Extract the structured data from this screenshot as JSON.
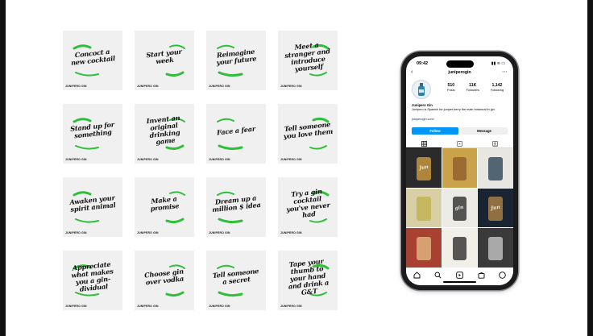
{
  "colors": {
    "tile_bg": "#f0f0f0",
    "lettering": "#111111",
    "brand_green": "#2fbf3a",
    "ig_blue": "#0095f6"
  },
  "tiles": [
    {
      "text": "Concoct a new cocktail"
    },
    {
      "text": "Start your week"
    },
    {
      "text": "Reimagine your future"
    },
    {
      "text": "Meet a stranger and introduce yourself"
    },
    {
      "text": "Stand up for something"
    },
    {
      "text": "Invent an original drinking game"
    },
    {
      "text": "Face a fear"
    },
    {
      "text": "Tell someone you love them"
    },
    {
      "text": "Awaken your spirit animal"
    },
    {
      "text": "Make a promise"
    },
    {
      "text": "Dream up a million $ idea"
    },
    {
      "text": "Try a gin cocktail you've never had"
    },
    {
      "text": "Appreciate what makes you a gin-dividual"
    },
    {
      "text": "Choose gin over vodka"
    },
    {
      "text": "Tell someone a secret"
    },
    {
      "text": "Tape your thumb to your hand and drink a G&T"
    }
  ],
  "tile_brand": "JUNIPERO GIN",
  "phone": {
    "time": "09:42",
    "status_icons": "▮▮ ≋ ▭",
    "username": "juniperogin",
    "stats": [
      {
        "value": "510",
        "label": "Posts"
      },
      {
        "value": "11K",
        "label": "Followers"
      },
      {
        "value": "1,142",
        "label": "Following"
      }
    ],
    "bio_name": "Junipero Gin",
    "bio_text": "Junipero is Spanish for juniper berry the main botanical in gin.",
    "bio_link": "juniperogin.com/",
    "follow_label": "Follow",
    "message_label": "Message",
    "tabs": [
      "grid-icon",
      "reels-icon",
      "tagged-icon"
    ],
    "feed": [
      {
        "bg": "#2b2b2b",
        "accent": "#d9a441",
        "mark": "Jun"
      },
      {
        "bg": "#c9a24a",
        "accent": "#8a5a2a",
        "mark": ""
      },
      {
        "bg": "#e8e6e1",
        "accent": "#1f3a4d",
        "mark": ""
      },
      {
        "bg": "#d8cfa6",
        "accent": "#c0b04a",
        "mark": ""
      },
      {
        "bg": "#ecebe6",
        "accent": "#222222",
        "mark": "gin"
      },
      {
        "bg": "#1a2433",
        "accent": "#b88a4a",
        "mark": "Jun"
      },
      {
        "bg": "#a94132",
        "accent": "#e6c08a",
        "mark": ""
      },
      {
        "bg": "#f2efe9",
        "accent": "#222222",
        "mark": ""
      },
      {
        "bg": "#3a3a3a",
        "accent": "#cfcfcf",
        "mark": ""
      }
    ],
    "nav_icons": [
      "home-icon",
      "search-icon",
      "reels-icon",
      "shop-icon",
      "profile-icon"
    ]
  }
}
